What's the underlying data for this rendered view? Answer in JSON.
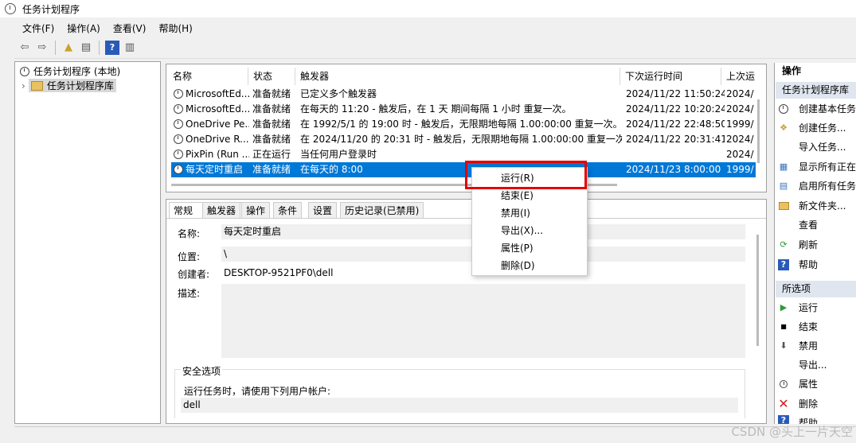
{
  "window": {
    "title": "任务计划程序"
  },
  "menu": [
    "文件(F)",
    "操作(A)",
    "查看(V)",
    "帮助(H)"
  ],
  "tree": {
    "root": "任务计划程序 (本地)",
    "child": "任务计划程序库"
  },
  "task_list": {
    "columns": [
      "名称",
      "状态",
      "触发器",
      "下次运行时间",
      "上次运"
    ],
    "rows": [
      {
        "name": "MicrosoftEd...",
        "status": "准备就绪",
        "trigger": "已定义多个触发器",
        "next": "2024/11/22 11:50:24",
        "last": "2024/"
      },
      {
        "name": "MicrosoftEd...",
        "status": "准备就绪",
        "trigger": "在每天的 11:20 - 触发后，在 1 天 期间每隔 1 小时 重复一次。",
        "next": "2024/11/22 10:20:24",
        "last": "2024/"
      },
      {
        "name": "OneDrive Pe...",
        "status": "准备就绪",
        "trigger": "在 1992/5/1 的 19:00 时 - 触发后，无限期地每隔 1.00:00:00 重复一次。",
        "next": "2024/11/22 22:48:50",
        "last": "1999/"
      },
      {
        "name": "OneDrive R...",
        "status": "准备就绪",
        "trigger": "在 2024/11/20 的 20:31 时 - 触发后，无限期地每隔 1.00:00:00 重复一次。",
        "next": "2024/11/22 20:31:41",
        "last": "2024/"
      },
      {
        "name": "PixPin (Run ...",
        "status": "正在运行",
        "trigger": "当任何用户登录时",
        "next": "",
        "last": "2024/"
      },
      {
        "name": "每天定时重启",
        "status": "准备就绪",
        "trigger": "在每天的 8:00",
        "next": "2024/11/23 8:00:00",
        "last": "1999/"
      }
    ]
  },
  "tabs": [
    "常规",
    "触发器",
    "操作",
    "条件",
    "设置",
    "历史记录(已禁用)"
  ],
  "general": {
    "name_label": "名称:",
    "name_value": "每天定时重启",
    "location_label": "位置:",
    "location_value": "\\",
    "author_label": "创建者:",
    "author_value": "DESKTOP-9521PF0\\dell",
    "desc_label": "描述:",
    "security_title": "安全选项",
    "run_as_label": "运行任务时，请使用下列用户帐户:",
    "run_as_value": "dell"
  },
  "context_menu": [
    "运行(R)",
    "结束(E)",
    "禁用(I)",
    "导出(X)...",
    "属性(P)",
    "删除(D)"
  ],
  "actions": {
    "header": "操作",
    "section1": "任务计划程序库",
    "items1": [
      "创建基本任务",
      "创建任务...",
      "导入任务...",
      "显示所有正在",
      "启用所有任务",
      "新文件夹...",
      "查看",
      "刷新",
      "帮助"
    ],
    "section2": "所选项",
    "items2": [
      "运行",
      "结束",
      "禁用",
      "导出...",
      "属性",
      "删除",
      "帮助"
    ]
  },
  "watermark": "CSDN @头上一片天空",
  "colors": {
    "selection": "#0078d7",
    "highlight_box": "#e60000",
    "action_header": "#dfe6ef"
  }
}
